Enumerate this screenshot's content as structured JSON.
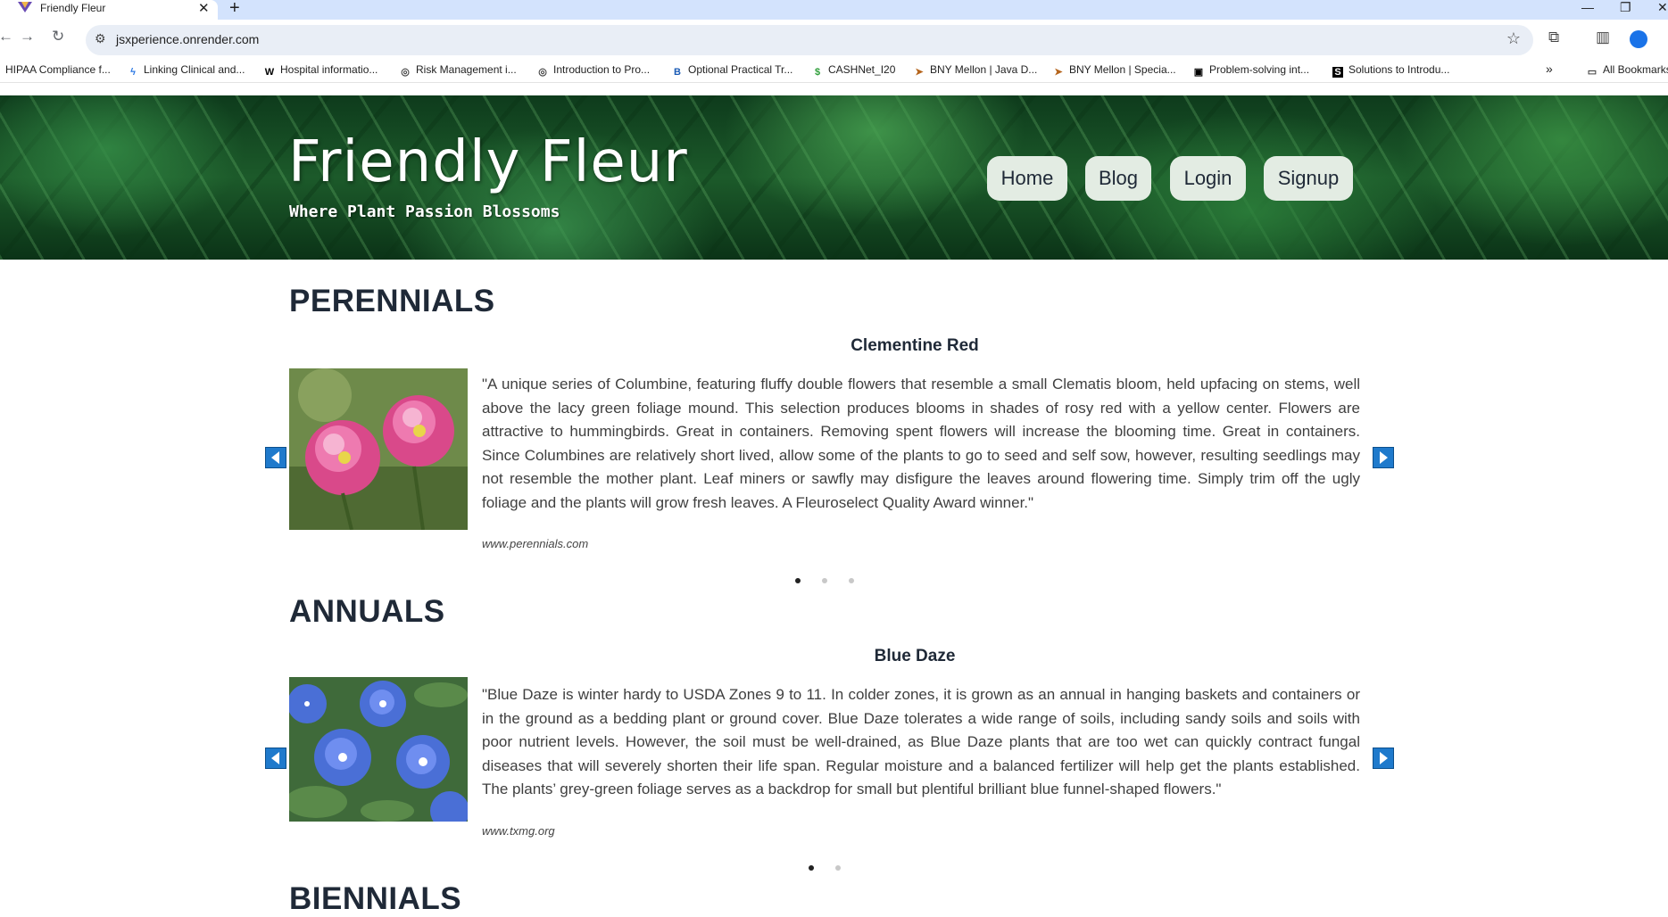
{
  "browser": {
    "tab_title": "Friendly Fleur",
    "url": "jsxperience.onrender.com",
    "bookmarks": [
      "HIPAA Compliance f...",
      "Linking Clinical and...",
      "Hospital informatio...",
      "Risk Management i...",
      "Introduction to Pro...",
      "Optional Practical Tr...",
      "CASHNet_I20",
      "BNY Mellon | Java D...",
      "BNY Mellon | Specia...",
      "Problem-solving int...",
      "Solutions to Introdu..."
    ],
    "all_bookmarks": "All Bookmarks"
  },
  "header": {
    "brand": "Friendly Fleur",
    "tagline": "Where Plant Passion Blossoms",
    "nav": [
      "Home",
      "Blog",
      "Login",
      "Signup"
    ]
  },
  "sections": [
    {
      "title": "PERENNIALS",
      "plant_name": "Clementine Red",
      "description": "\"A unique series of Columbine, featuring fluffy double flowers that resemble a small Clematis bloom, held upfacing on stems, well above the lacy green foliage mound. This selection produces blooms in shades of rosy red with a yellow center. Flowers are attractive to hummingbirds. Great in containers. Removing spent flowers will increase the blooming time. Great in containers. Since Columbines are relatively short lived, allow some of the plants to go to seed and self sow, however, resulting seedlings may not resemble the mother plant. Leaf miners or sawfly may disfigure the leaves around flowering time. Simply trim off the ugly foliage and the plants will grow fresh leaves. A Fleuroselect Quality Award winner.\"",
      "source": "www.perennials.com",
      "slides": 3,
      "active_slide": 1
    },
    {
      "title": "ANNUALS",
      "plant_name": "Blue Daze",
      "description": "\"Blue Daze is winter hardy to USDA Zones 9 to 11. In colder zones, it is grown as an annual in hanging baskets and containers or in the ground as a bedding plant or ground cover. Blue Daze tolerates a wide range of soils, including sandy soils and soils with poor nutrient levels. However, the soil must be well-drained, as Blue Daze plants that are too wet can quickly contract fungal diseases that will severely shorten their life span. Regular moisture and a balanced fertilizer will help get the plants established. The plants’ grey-green foliage serves as a backdrop for small but plentiful brilliant blue funnel-shaped flowers.\"",
      "source": "www.txmg.org",
      "slides": 2,
      "active_slide": 1
    },
    {
      "title": "BIENNIALS"
    }
  ],
  "colors": {
    "nav_button_bg": "#e3ece3",
    "heading": "#1f2937",
    "arrow_bg": "#1f7acc",
    "chrome_tabstrip": "#d3e3fd"
  }
}
